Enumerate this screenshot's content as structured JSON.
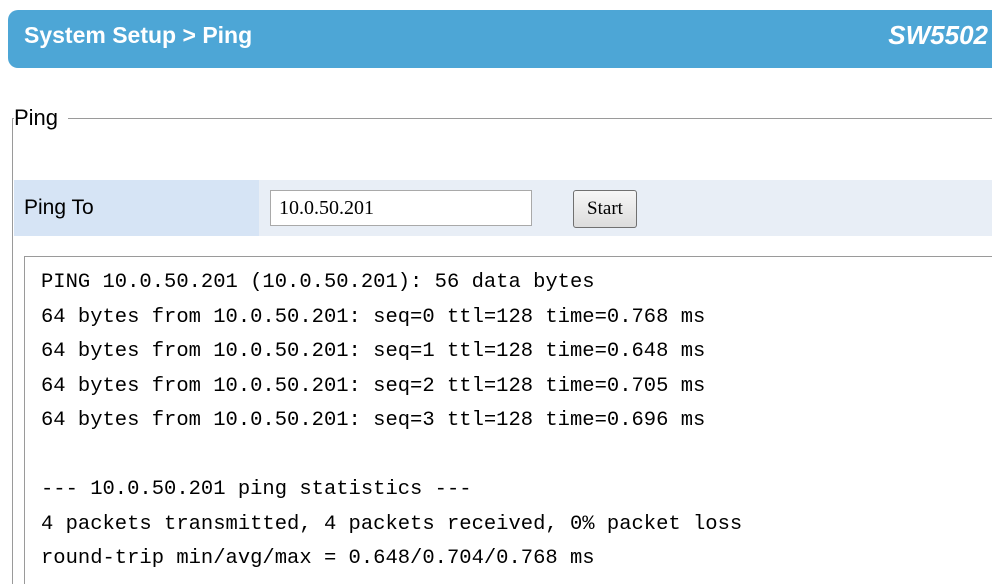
{
  "header": {
    "breadcrumb": "System Setup > Ping",
    "model": "SW5502"
  },
  "section": {
    "legend": "Ping"
  },
  "ping_to": {
    "label": "Ping To",
    "value": "10.0.50.201",
    "start_label": "Start"
  },
  "output": {
    "lines": [
      "PING 10.0.50.201 (10.0.50.201): 56 data bytes",
      "64 bytes from 10.0.50.201: seq=0 ttl=128 time=0.768 ms",
      "64 bytes from 10.0.50.201: seq=1 ttl=128 time=0.648 ms",
      "64 bytes from 10.0.50.201: seq=2 ttl=128 time=0.705 ms",
      "64 bytes from 10.0.50.201: seq=3 ttl=128 time=0.696 ms",
      "",
      "--- 10.0.50.201 ping statistics ---",
      "4 packets transmitted, 4 packets received, 0% packet loss",
      "round-trip min/avg/max = 0.648/0.704/0.768 ms"
    ]
  },
  "colors": {
    "header_bg": "#4da6d6",
    "label_cell_bg": "#d6e4f5",
    "row_bg": "#e8eef6"
  }
}
